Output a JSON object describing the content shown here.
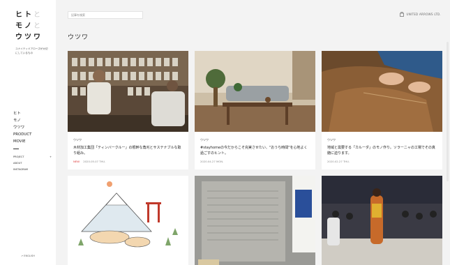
{
  "logo": {
    "rows": [
      {
        "a": "ヒ",
        "b": "ト",
        "c": "と"
      },
      {
        "a": "モ",
        "b": "ノ",
        "c": "と"
      },
      {
        "a": "ウ",
        "b": "ツ",
        "c": "ワ"
      }
    ],
    "tagline": "ユナイテッドアローズが大切にしているもの"
  },
  "nav": {
    "items": [
      "ヒト",
      "モノ",
      "ウツワ",
      "PRODUCT",
      "MOVIE"
    ],
    "small": [
      {
        "label": "PROJECT",
        "suffix": "+"
      },
      {
        "label": "ABOUT",
        "suffix": ""
      },
      {
        "label": "INSTAGRAM",
        "suffix": ""
      }
    ]
  },
  "bottom_link": "ENGLISH",
  "search": {
    "placeholder": "記事を検索"
  },
  "brand": "UNITED ARROWS LTD.",
  "page_title": "ウツワ",
  "cards": [
    {
      "category": "ウツワ",
      "title": "木材加工集団「ティンバークルー」の根幹な角刈とサステナブルな取り組み。",
      "badge": "NEW",
      "date": "2020.05.07 THU."
    },
    {
      "category": "ウツワ",
      "title": "#stayhomeの今だからこそ充実させたい、\"おうち時間\"を心地よく過ごすのヒント。",
      "badge": "",
      "date": "2020.04.27 MON."
    },
    {
      "category": "ウツワ",
      "title": "地域と需要する「カルーダ」のモノ作り。ソラーニャの工場でその真髄に迫ります。",
      "badge": "",
      "date": "2020.02.27 THU."
    }
  ],
  "colors": {
    "accent_new": "#dd3333",
    "background": "#f3f3f3",
    "sidebar": "#ffffff"
  }
}
